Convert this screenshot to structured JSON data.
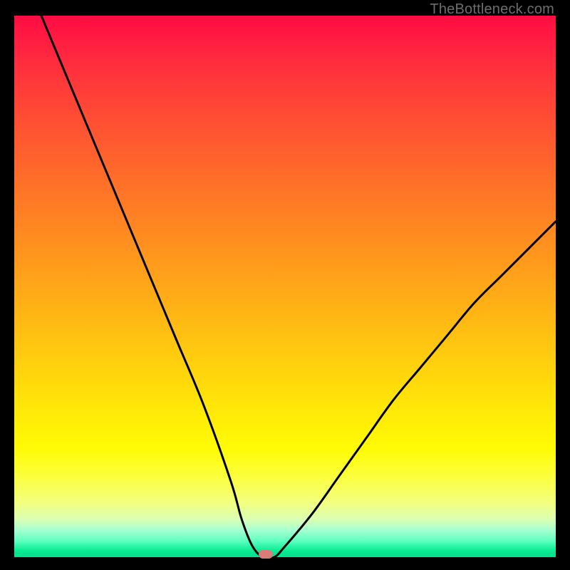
{
  "watermark": "TheBottleneck.com",
  "chart_data": {
    "type": "line",
    "title": "",
    "xlabel": "",
    "ylabel": "",
    "x_range": [
      0,
      100
    ],
    "y_range": [
      0,
      100
    ],
    "gridlines": false,
    "legend": false,
    "series": [
      {
        "name": "curve",
        "x": [
          5,
          10,
          15,
          20,
          25,
          30,
          35,
          40,
          42,
          44,
          46,
          48,
          50,
          55,
          60,
          65,
          70,
          75,
          80,
          85,
          90,
          95,
          100
        ],
        "y": [
          100,
          88,
          76,
          64,
          52,
          40,
          28,
          14,
          7,
          2,
          0,
          0,
          2,
          8,
          15,
          22,
          29,
          35,
          41,
          47,
          52,
          57,
          62
        ]
      }
    ],
    "marker": {
      "x": 46.5,
      "y": 0.5,
      "color": "#d87d78"
    },
    "background_gradient": {
      "top": "#ff0b43",
      "bottom": "#03e18d"
    }
  }
}
